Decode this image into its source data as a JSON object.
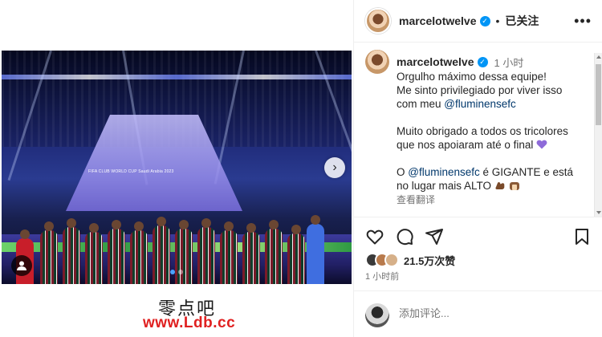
{
  "post": {
    "username": "marcelotwelve",
    "follow_state": "已关注",
    "separator": "•",
    "time_ago": "1 小时",
    "caption": {
      "line1": "Orgulho máximo dessa equipe!",
      "line2": "Me sinto privilegiado por viver isso",
      "line3_prefix": "com meu ",
      "mention_1": "@fluminensefc",
      "para2_line1": "Muito obrigado a todos os tricolores",
      "para2_line2": "que nos apoiaram até o final",
      "para3_prefix": "O ",
      "mention_2": "@fluminensefc",
      "para3_mid": " é GIGANTE e está",
      "para3_line2": "no lugar mais ALTO",
      "see_translation": "查看翻译"
    },
    "likes": "21.5万次赞",
    "timestamp": "1 小时前",
    "comment_placeholder": "添加评论..."
  },
  "media": {
    "stage_text": "FIFA CLUB WORLD CUP Saudi Arabia 2023",
    "board_text": "WORLD CU",
    "carousel_count": 2,
    "carousel_active": 1
  },
  "watermark": {
    "text_cn": "零点吧",
    "url": "www.Ldb.cc"
  },
  "colors": {
    "verified": "#0095f6",
    "mention": "#00376b",
    "muted": "#737373",
    "heart_emoji": "#8e6bd9",
    "watermark_url": "#e02020"
  }
}
